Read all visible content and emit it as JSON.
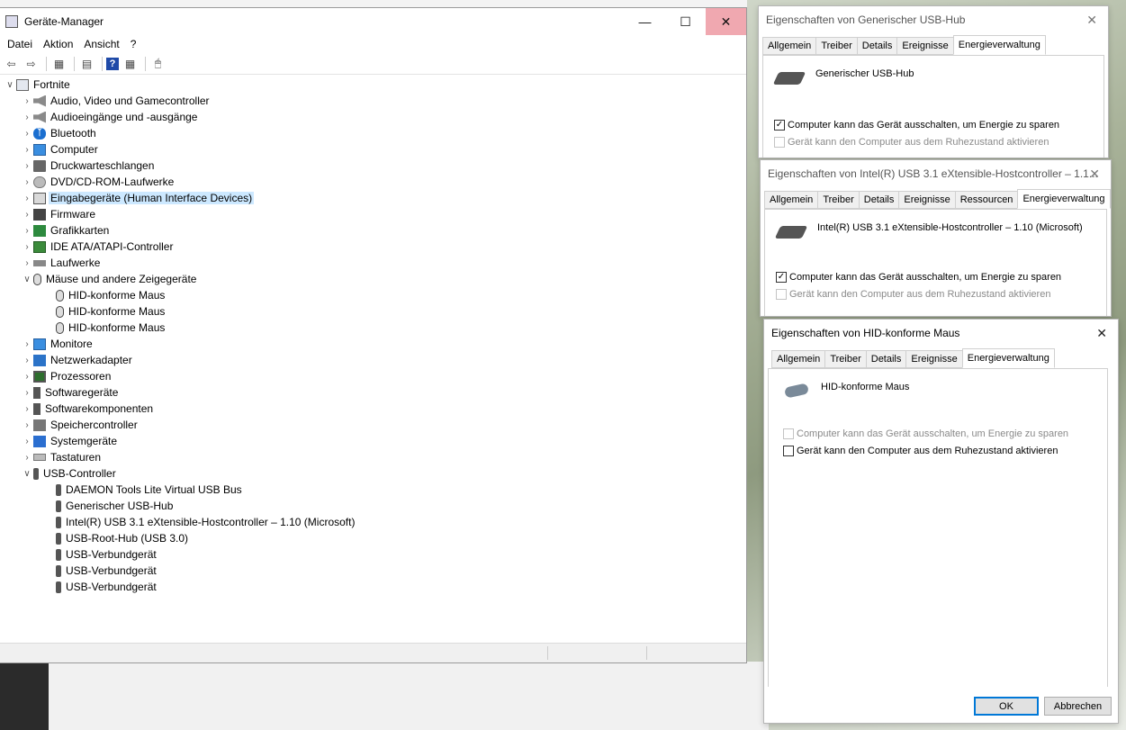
{
  "device_manager": {
    "title": "Geräte-Manager",
    "menu": [
      "Datei",
      "Aktion",
      "Ansicht",
      "?"
    ],
    "toolbar_help": "?",
    "root": "Fortnite",
    "categories": [
      {
        "label": "Audio, Video und Gamecontroller",
        "icon": "speaker-icon"
      },
      {
        "label": "Audioeingänge und -ausgänge",
        "icon": "speaker-icon"
      },
      {
        "label": "Bluetooth",
        "icon": "bluetooth-icon"
      },
      {
        "label": "Computer",
        "icon": "monitor-icon"
      },
      {
        "label": "Druckwarteschlangen",
        "icon": "printer-icon"
      },
      {
        "label": "DVD/CD-ROM-Laufwerke",
        "icon": "disc-drive-icon"
      },
      {
        "label": "Eingabegeräte (Human Interface Devices)",
        "icon": "hid-icon"
      },
      {
        "label": "Firmware",
        "icon": "chip-icon"
      },
      {
        "label": "Grafikkarten",
        "icon": "display-adapter-icon"
      },
      {
        "label": "IDE ATA/ATAPI-Controller",
        "icon": "ide-controller-icon"
      },
      {
        "label": "Laufwerke",
        "icon": "drive-icon"
      },
      {
        "label": "Mäuse und andere Zeigegeräte",
        "icon": "mouse-icon"
      },
      {
        "label": "Monitore",
        "icon": "monitor-icon"
      },
      {
        "label": "Netzwerkadapter",
        "icon": "network-icon"
      },
      {
        "label": "Prozessoren",
        "icon": "cpu-icon"
      },
      {
        "label": "Softwaregeräte",
        "icon": "software-device-icon"
      },
      {
        "label": "Softwarekomponenten",
        "icon": "software-component-icon"
      },
      {
        "label": "Speichercontroller",
        "icon": "storage-controller-icon"
      },
      {
        "label": "Systemgeräte",
        "icon": "system-device-icon"
      },
      {
        "label": "Tastaturen",
        "icon": "keyboard-icon"
      },
      {
        "label": "USB-Controller",
        "icon": "usb-icon"
      }
    ],
    "mice": [
      "HID-konforme Maus",
      "HID-konforme Maus",
      "HID-konforme Maus"
    ],
    "usb_devices": [
      "DAEMON Tools Lite Virtual USB Bus",
      "Generischer USB-Hub",
      "Intel(R) USB 3.1 eXtensible-Hostcontroller – 1.10 (Microsoft)",
      "USB-Root-Hub (USB 3.0)",
      "USB-Verbundgerät",
      "USB-Verbundgerät",
      "USB-Verbundgerät"
    ],
    "selected": "Eingabegeräte (Human Interface Devices)"
  },
  "dialog_hub": {
    "title": "Eigenschaften von Generischer USB-Hub",
    "tabs": [
      "Allgemein",
      "Treiber",
      "Details",
      "Ereignisse",
      "Energieverwaltung"
    ],
    "active_tab": "Energieverwaltung",
    "device": "Generischer USB-Hub",
    "opt1": "Computer kann das Gerät ausschalten, um Energie zu sparen",
    "opt1_checked": true,
    "opt2": "Gerät kann den Computer aus dem Ruhezustand aktivieren",
    "opt2_checked": false
  },
  "dialog_intel": {
    "title": "Eigenschaften von Intel(R) USB 3.1 eXtensible-Hostcontroller – 1.1...",
    "tabs": [
      "Allgemein",
      "Treiber",
      "Details",
      "Ereignisse",
      "Ressourcen",
      "Energieverwaltung"
    ],
    "active_tab": "Energieverwaltung",
    "device": "Intel(R) USB 3.1 eXtensible-Hostcontroller – 1.10 (Microsoft)",
    "opt1": "Computer kann das Gerät ausschalten, um Energie zu sparen",
    "opt1_checked": true,
    "opt2": "Gerät kann den Computer aus dem Ruhezustand aktivieren",
    "opt2_checked": false
  },
  "dialog_mouse": {
    "title": "Eigenschaften von HID-konforme Maus",
    "tabs": [
      "Allgemein",
      "Treiber",
      "Details",
      "Ereignisse",
      "Energieverwaltung"
    ],
    "active_tab": "Energieverwaltung",
    "device": "HID-konforme Maus",
    "opt1": "Computer kann das Gerät ausschalten, um Energie zu sparen",
    "opt1_checked": false,
    "opt2": "Gerät kann den Computer aus dem Ruhezustand aktivieren",
    "opt2_checked": false,
    "ok_label": "OK",
    "cancel_label": "Abbrechen"
  }
}
